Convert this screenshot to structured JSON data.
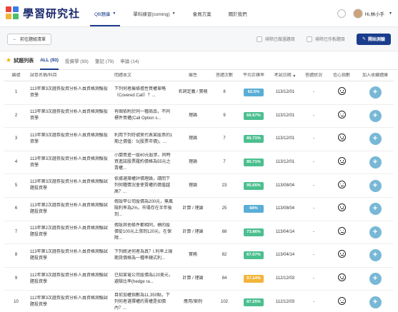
{
  "logo": {
    "text": "學習研究社"
  },
  "nav": {
    "items": [
      {
        "label": "QB題庫",
        "caret": "▼",
        "active": true
      },
      {
        "label": "單科練習(coming)",
        "caret": "▼",
        "active": false
      },
      {
        "label": "會員方案",
        "caret": "",
        "active": false
      },
      {
        "label": "關於我們",
        "caret": "",
        "active": false
      }
    ],
    "user_name": "Hi,林小手",
    "user_caret": "▼"
  },
  "toolbar": {
    "back_label": "前往題組清單",
    "exclude_done_label": "排除已做過題目",
    "exclude_wrong_label": "排除已作對題目",
    "start_label": "開始測驗"
  },
  "tabs": {
    "title": "試題列表",
    "items": [
      {
        "label": "ALL (93)",
        "active": true
      },
      {
        "label": "投資學 (93)",
        "active": false
      },
      {
        "label": "筆記 (79)",
        "active": false
      },
      {
        "label": "申論 (14)",
        "active": false
      }
    ]
  },
  "table": {
    "headers": {
      "idx": "編號",
      "name": "試卷名稱/科目",
      "question": "問題本文",
      "attr": "屬性",
      "count": "答題次數",
      "rate": "平均正確率",
      "date": "考試日期",
      "status": "答題狀況",
      "confidence": "信心指數",
      "add": "加入收藏題庫"
    },
    "rows": [
      {
        "idx": "1",
        "name": "113年第3次證券投資分析人員資格測驗投資學",
        "question": "下列何者屬條擔性買權單略（Covered Call）？...",
        "attr": "名詞定義 / 實務",
        "count": "8",
        "rate": "62.5%",
        "rate_color": "#5aaed6",
        "date": "113/12/01",
        "status": "-"
      },
      {
        "idx": "2",
        "name": "113年第3次證券投資分析人員資格測驗投資學",
        "question": "有關依附於同一種商品，不同標件買權(Call Option s...",
        "attr": "理論",
        "count": "9",
        "rate": "66.67%",
        "rate_color": "#4bbf8f",
        "date": "113/12/01",
        "status": "-"
      },
      {
        "idx": "3",
        "name": "113年第3次證券投資分析人員資格測驗投資學",
        "question": "利用下列符號來代表某股票的1期之價值：S(股票市價)，...",
        "attr": "理論",
        "count": "7",
        "rate": "85.71%",
        "rate_color": "#4bbf8f",
        "date": "113/12/01",
        "status": "-"
      },
      {
        "idx": "4",
        "name": "113年第3次證券投資分析人員資格測驗投資學",
        "question": "小蘭買進一股60元股票，同時買進該股票履約價格為55元之賣權...",
        "attr": "理論",
        "count": "7",
        "rate": "85.71%",
        "rate_color": "#4bbf8f",
        "date": "113/12/01",
        "status": "-"
      },
      {
        "idx": "5",
        "name": "113年第3次證券投資分析人員資格測驗試題投資學",
        "question": "依據選擇權評價理論，請問下列何種情況會使賣權的價值越高？...",
        "attr": "理論",
        "count": "23",
        "rate": "95.65%",
        "rate_color": "#4bbf8f",
        "date": "113/08/04",
        "status": "-"
      },
      {
        "idx": "6",
        "name": "113年第2次證券投資分析人員資格測驗試題投資學",
        "question": "假設甲公司股價為200元，無風險利率為2%，市場存在半年後到...",
        "attr": "計算 / 理論",
        "count": "25",
        "rate": "68%",
        "rate_color": "#5aaed6",
        "date": "113/08/04",
        "status": "-"
      },
      {
        "idx": "7",
        "name": "113年第2次證券投資分析人員資格測驗試題投資學",
        "question": "假設其他條件都相同，標的股價從100元上漲到120元，在保障...",
        "attr": "計算 / 理論",
        "count": "88",
        "rate": "73.86%",
        "rate_color": "#4bbf8f",
        "date": "113/04/14",
        "status": "-"
      },
      {
        "idx": "8",
        "name": "113年第1次證券投資分析人員資格測驗試題投資學",
        "question": "下列敘述何者為真？I.利率上揚期貨價格為一種率鏈式利...",
        "attr": "實務",
        "count": "82",
        "rate": "67.07%",
        "rate_color": "#4bbf8f",
        "date": "113/04/14",
        "status": "-"
      },
      {
        "idx": "9",
        "name": "112年第3次證券投資分析人員資格測驗試題投資學",
        "question": "已知某電公司股價為120美元，避險比率(hedge ra...",
        "attr": "計算 / 理論",
        "count": "84",
        "rate": "57.14%",
        "rate_color": "#f2b43a",
        "date": "112/12/03",
        "status": "-"
      },
      {
        "idx": "10",
        "name": "112年第3次證券投資分析人員資格測驗試題投資學",
        "question": "目前加權指數為11,350點，下列何者選擇權的賣權是如價內？...",
        "attr": "應用/案例",
        "count": "102",
        "rate": "87.25%",
        "rate_color": "#4bbf8f",
        "date": "112/12/03",
        "status": "-"
      }
    ]
  }
}
